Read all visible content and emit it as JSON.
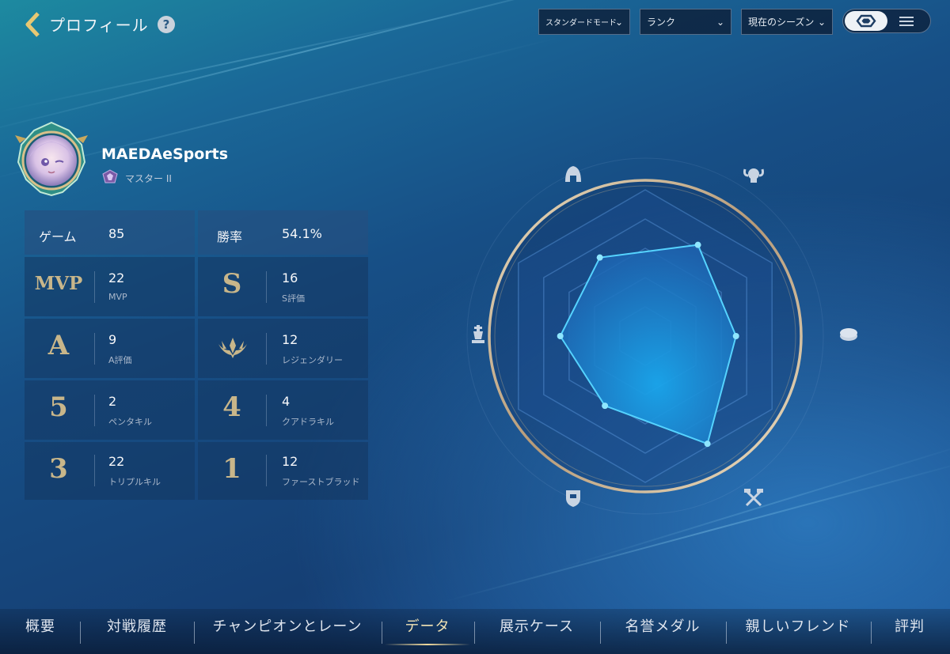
{
  "header": {
    "title": "プロフィール",
    "help_glyph": "?",
    "filters": [
      {
        "label": "スタンダードモード"
      },
      {
        "label": "ランク"
      },
      {
        "label": "現在のシーズン"
      }
    ]
  },
  "profile": {
    "name": "MAEDAeSports",
    "rank": "マスター II"
  },
  "stats": {
    "games_label": "ゲーム",
    "games_value": "85",
    "winrate_label": "勝率",
    "winrate_value": "54.1%",
    "rows": [
      [
        {
          "icon": "MVP",
          "value": "22",
          "label": "MVP"
        },
        {
          "icon": "S",
          "value": "16",
          "label": "S評価"
        }
      ],
      [
        {
          "icon": "A",
          "value": "9",
          "label": "A評価"
        },
        {
          "icon": "legendary-icon",
          "value": "12",
          "label": "レジェンダリー"
        }
      ],
      [
        {
          "icon": "5",
          "value": "2",
          "label": "ペンタキル"
        },
        {
          "icon": "4",
          "value": "4",
          "label": "クアドラキル"
        }
      ],
      [
        {
          "icon": "3",
          "value": "22",
          "label": "トリプルキル"
        },
        {
          "icon": "1",
          "value": "12",
          "label": "ファーストブラッド"
        }
      ]
    ]
  },
  "radar": {
    "axes": [
      "helmet-icon",
      "ram-skull-icon",
      "coin-icon",
      "crossed-hammers-icon",
      "shield-icon",
      "chess-king-icon"
    ],
    "values": [
      0.62,
      0.72,
      0.62,
      0.85,
      0.55,
      0.58
    ],
    "accent": "#3fc6f5"
  },
  "tabs": [
    "概要",
    "対戦履歴",
    "チャンピオンとレーン",
    "データ",
    "展示ケース",
    "名誉メダル",
    "親しいフレンド",
    "評判"
  ],
  "active_tab": "データ"
}
